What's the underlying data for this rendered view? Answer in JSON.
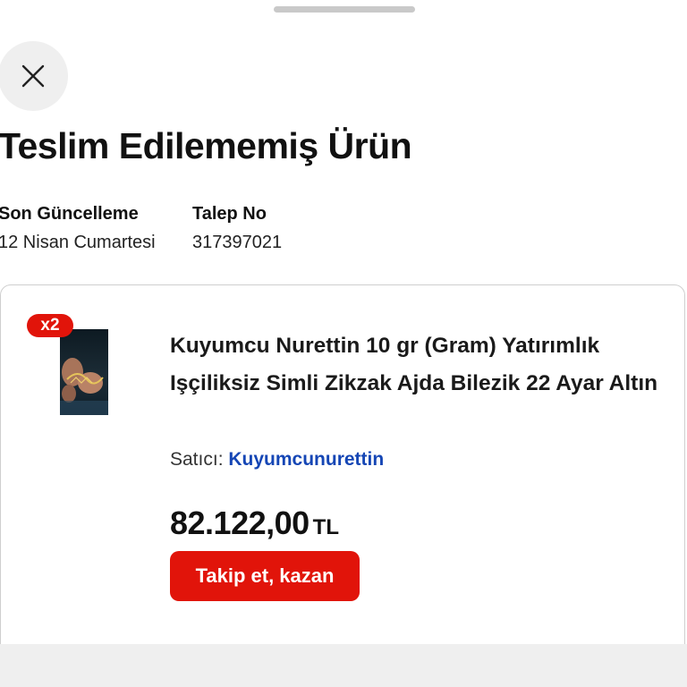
{
  "header": {
    "title": "Teslim Edilememiş Ürün"
  },
  "meta": {
    "last_update_label": "Son Güncelleme",
    "last_update_value": "12 Nisan Cumartesi",
    "request_label": "Talep No",
    "request_value": "317397021"
  },
  "product": {
    "quantity_badge": "x2",
    "title": "Kuyumcu Nurettin 10 gr (Gram) Yatırımlık Işçiliksiz Simli Zikzak Ajda Bilezik 22 Ayar Altın",
    "seller_label": "Satıcı:",
    "seller_name": "Kuyumcunurettin",
    "price": "82.122,00",
    "currency": "TL",
    "cta_label": "Takip et, kazan"
  },
  "icons": {
    "close": "close-icon"
  },
  "colors": {
    "accent": "#e1140a",
    "link": "#1546b5"
  }
}
